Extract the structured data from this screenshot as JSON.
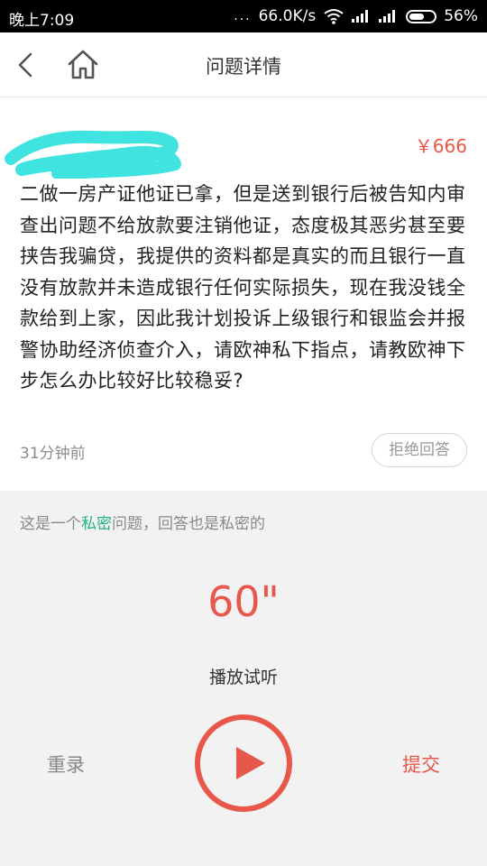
{
  "status_bar": {
    "time": "晚上7:09",
    "dots": "...",
    "network_speed": "66.0K/s",
    "battery": "56%"
  },
  "nav": {
    "title": "问题详情",
    "back_icon": "chevron-left-icon",
    "home_icon": "home-icon"
  },
  "question": {
    "price": "￥666",
    "text": "二做一房产证他证已拿，但是送到银行后被告知内审查出问题不给放款要注销他证，态度极其恶劣甚至要挟告我骗贷，我提供的资料都是真实的而且银行一直没有放款并未造成银行任何实际损失，现在我没钱全款给到上家，因此我计划投诉上级银行和银监会并报警协助经济侦查介入，请欧神私下指点，请教欧神下步怎么办比较好比较稳妥?",
    "time_ago": "31分钟前",
    "reject_label": "拒绝回答"
  },
  "answer": {
    "private_note_prefix": "这是一个",
    "private_note_highlight": "私密",
    "private_note_suffix": "问题，回答也是私密的",
    "duration": "60\"",
    "listen_label": "播放试听",
    "rerecord_label": "重录",
    "submit_label": "提交",
    "play_icon": "play-icon"
  },
  "colors": {
    "accent": "#e7574a",
    "private_highlight": "#1fb37d",
    "redaction": "#3fe3e0"
  }
}
